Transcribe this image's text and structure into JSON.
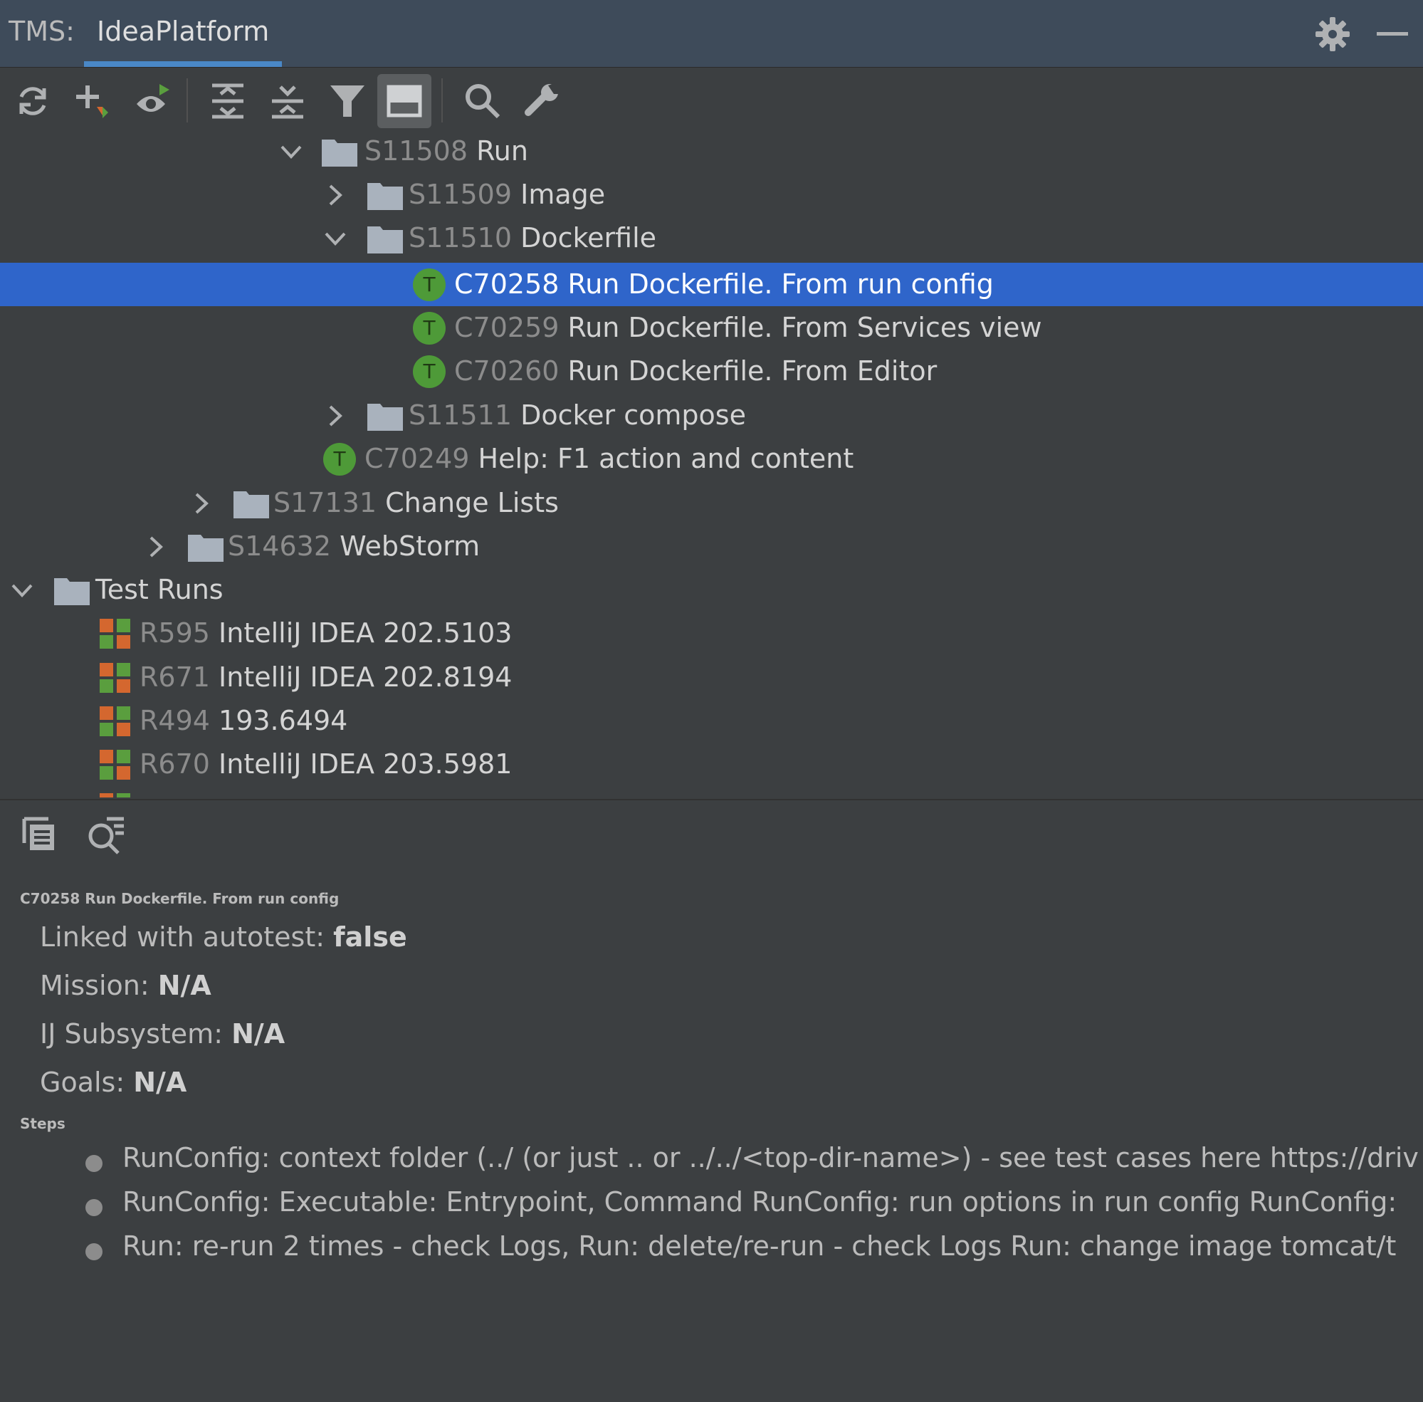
{
  "titlebar": {
    "prefix": "TMS:",
    "tab": "IdeaPlatform"
  },
  "tree": [
    {
      "id": "S11508",
      "name": "Run",
      "kind": "folder",
      "chevron": "down"
    },
    {
      "id": "S11509",
      "name": "Image",
      "kind": "folder",
      "chevron": "right"
    },
    {
      "id": "S11510",
      "name": "Dockerfile",
      "kind": "folder",
      "chevron": "down"
    },
    {
      "id": "C70258",
      "name": "Run Dockerfile. From run config",
      "kind": "test",
      "selected": true
    },
    {
      "id": "C70259",
      "name": "Run Dockerfile. From Services view",
      "kind": "test"
    },
    {
      "id": "C70260",
      "name": "Run Dockerfile. From Editor",
      "kind": "test"
    },
    {
      "id": "S11511",
      "name": "Docker compose",
      "kind": "folder",
      "chevron": "right"
    },
    {
      "id": "C70249",
      "name": "Help: F1 action and content",
      "kind": "test"
    },
    {
      "id": "S17131",
      "name": "Change Lists",
      "kind": "folder",
      "chevron": "right"
    },
    {
      "id": "S14632",
      "name": "WebStorm",
      "kind": "folder",
      "chevron": "right"
    },
    {
      "id": "",
      "name": "Test Runs",
      "kind": "folder",
      "chevron": "down"
    },
    {
      "id": "R595",
      "name": "IntelliJ IDEA 202.5103",
      "kind": "run"
    },
    {
      "id": "R671",
      "name": "IntelliJ IDEA 202.8194",
      "kind": "run"
    },
    {
      "id": "R494",
      "name": "193.6494",
      "kind": "run"
    },
    {
      "id": "R670",
      "name": "IntelliJ IDEA 203.5981",
      "kind": "run"
    }
  ],
  "test_icon_letter": "T",
  "details": {
    "title": "C70258 Run Dockerfile. From run config",
    "props": [
      {
        "label": "Linked with autotest: ",
        "value": "false"
      },
      {
        "label": "Mission: ",
        "value": "N/A"
      },
      {
        "label": "IJ Subsystem: ",
        "value": "N/A"
      },
      {
        "label": "Goals: ",
        "value": "N/A"
      }
    ],
    "steps_heading": "Steps",
    "steps": [
      "RunConfig: context folder (../ (or just .. or ../../<top-dir-name>) - see test cases here https://driv",
      "RunConfig: Executable: Entrypoint, Command RunConfig: run options in run config   RunConfig:",
      "Run: re-run 2 times - check Logs,  Run: delete/re-run - check Logs Run: change image  tomcat/t"
    ]
  },
  "colors": {
    "selection": "#2f65ca",
    "test_icon": "#4e9a38",
    "folder": "#a9b2bd",
    "run_green": "#5a9e3e",
    "run_orange": "#d4672f"
  }
}
